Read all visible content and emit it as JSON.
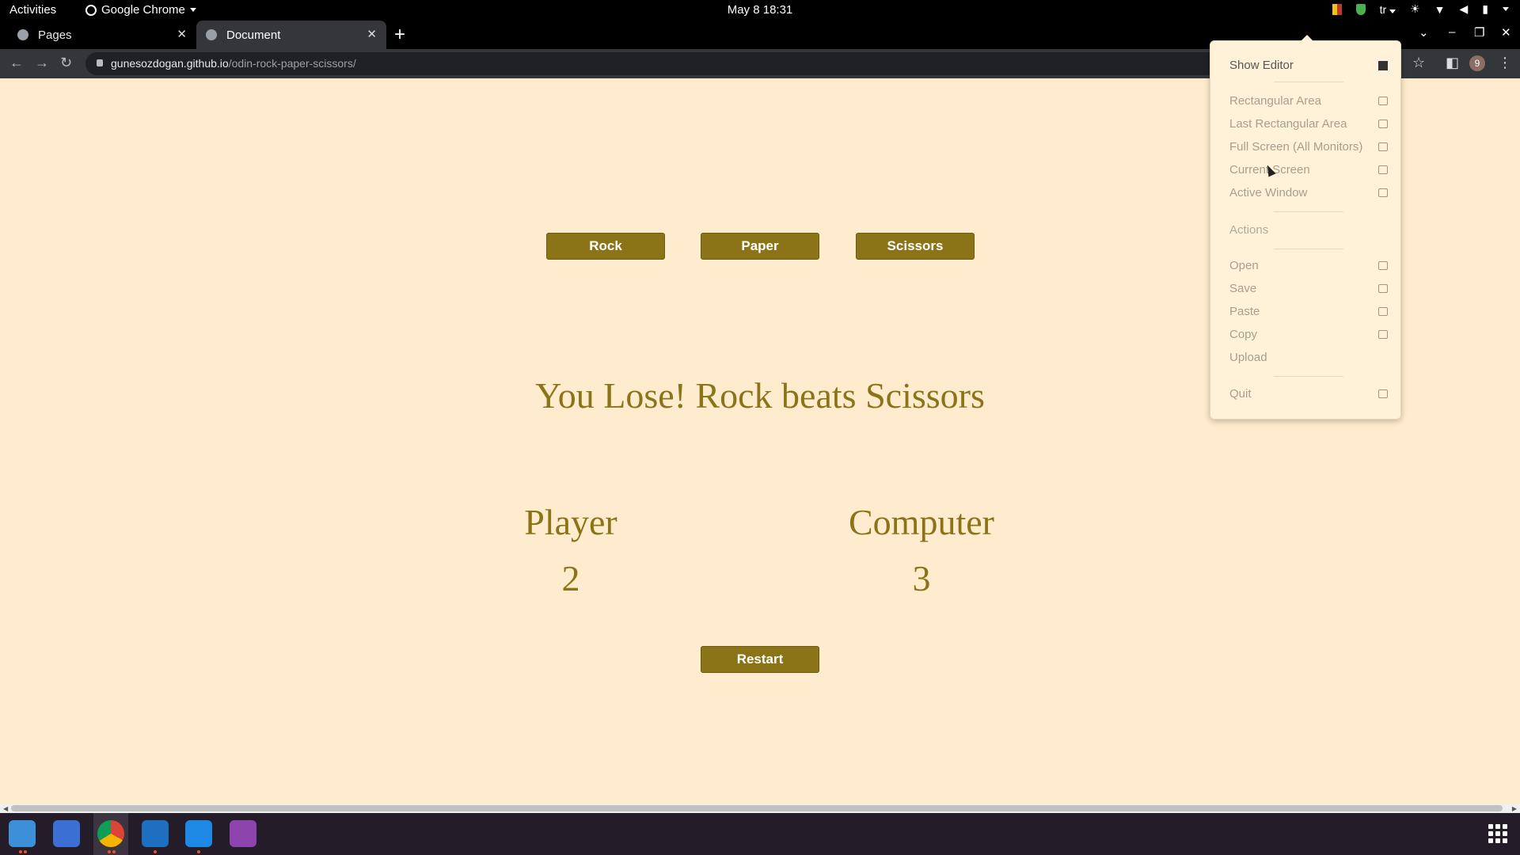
{
  "topbar": {
    "activities": "Activities",
    "app_name": "Google Chrome",
    "clock": "May 8  18:31",
    "lang": "tr"
  },
  "browser": {
    "tabs": [
      {
        "label": "Pages"
      },
      {
        "label": "Document"
      }
    ],
    "url_host": "gunesozdogan.github.io",
    "url_path": "/odin-rock-paper-scissors/",
    "profile_badge": "9"
  },
  "game": {
    "choices": {
      "rock": "Rock",
      "paper": "Paper",
      "scissors": "Scissors"
    },
    "result": "You Lose! Rock beats Scissors",
    "player_label": "Player",
    "player_score": "2",
    "computer_label": "Computer",
    "computer_score": "3",
    "restart": "Restart"
  },
  "flameshot_menu": {
    "show_editor": "Show Editor",
    "capture": [
      "Rectangular Area",
      "Last Rectangular Area",
      "Full Screen (All Monitors)",
      "Current Screen",
      "Active Window"
    ],
    "actions_header": "Actions",
    "actions": [
      "Open",
      "Save",
      "Paste",
      "Copy",
      "Upload"
    ],
    "quit": "Quit"
  },
  "colors": {
    "page_bg": "#ffebcd",
    "accent": "#8b7418",
    "menu_bg": "#fff2d8"
  }
}
